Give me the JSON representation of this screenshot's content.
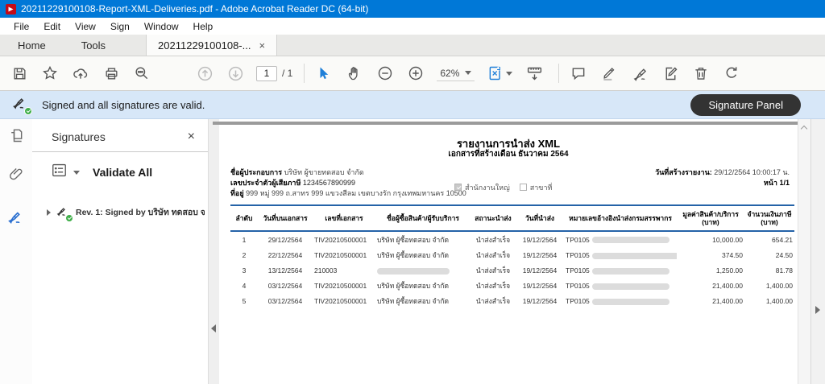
{
  "window": {
    "title": "20211229100108-Report-XML-Deliveries.pdf - Adobe Acrobat Reader DC (64-bit)"
  },
  "menu": {
    "items": [
      "File",
      "Edit",
      "View",
      "Sign",
      "Window",
      "Help"
    ]
  },
  "tab_bar": {
    "home": "Home",
    "tools": "Tools",
    "document": "20211229100108-...",
    "close_glyph": "×"
  },
  "toolbar": {
    "page_current": "1",
    "page_total": "/ 1",
    "zoom_level": "62%"
  },
  "signature_bar": {
    "message": "Signed and all signatures are valid.",
    "panel_button": "Signature Panel"
  },
  "signatures_panel": {
    "title": "Signatures",
    "close_glyph": "×",
    "validate_all": "Validate All",
    "revision": "Rev. 1: Signed by บริษัท ทดสอบ จ"
  },
  "pdf": {
    "title": "รายงานการนำส่ง XML",
    "subtitle": "เอกสารที่สร้างเดือน ธันวาคม 2564",
    "operator_label": "ชื่อผู้ประกอบการ",
    "operator_value": "บริษัท ผู้ขายทดสอบ จำกัด",
    "tax_id_label": "เลขประจำตัวผู้เสียภาษี",
    "tax_id_value": "1234567890999",
    "address_label": "ที่อยู่",
    "address_value": "999 หมู่ 999 ถ.สาทร 999 แขวงสีลม เขตบางรัก กรุงเทพมหานคร 10500",
    "head_office_label": "สำนักงานใหญ่",
    "branch_label": "สาขาที่",
    "report_date_label": "วันที่สร้างรายงาน:",
    "report_date_value": "29/12/2564 10:00:17 น.",
    "page_label": "หน้า 1/1",
    "table": {
      "columns": [
        {
          "label": "ลำดับ"
        },
        {
          "label": "วันที่บนเอกสาร"
        },
        {
          "label": "เลขที่เอกสาร"
        },
        {
          "label": "ชื่อผู้ซื้อสินค้า/ผู้รับบริการ"
        },
        {
          "label": "สถานะนำส่ง"
        },
        {
          "label": "วันที่นำส่ง"
        },
        {
          "label": "หมายเลขอ้างอิงนำส่งกรมสรรพากร"
        },
        {
          "label": "มูลค่าสินค้า/บริการ",
          "unit": "(บาท)"
        },
        {
          "label": "จำนวนเงินภาษี",
          "unit": "(บาท)"
        }
      ],
      "rows": [
        {
          "no": "1",
          "doc_date": "29/12/2564",
          "doc_no": "TIV20210500001",
          "buyer": "บริษัท ผู้ซื้อทดสอบ จำกัด",
          "status": "นำส่งสำเร็จ",
          "send_date": "19/12/2564",
          "ref": "TP0105",
          "amount": "10,000.00",
          "vat": "654.21"
        },
        {
          "no": "2",
          "doc_date": "22/12/2564",
          "doc_no": "TIV20210500001",
          "buyer": "บริษัท ผู้ซื้อทดสอบ จำกัด",
          "status": "นำส่งสำเร็จ",
          "send_date": "19/12/2564",
          "ref": "TP0105",
          "amount": "374.50",
          "vat": "24.50"
        },
        {
          "no": "3",
          "doc_date": "13/12/2564",
          "doc_no": "210003",
          "buyer": "",
          "status": "นำส่งสำเร็จ",
          "send_date": "19/12/2564",
          "ref": "TP0105",
          "amount": "1,250.00",
          "vat": "81.78"
        },
        {
          "no": "4",
          "doc_date": "03/12/2564",
          "doc_no": "TIV20210500001",
          "buyer": "บริษัท ผู้ซื้อทดสอบ จำกัด",
          "status": "นำส่งสำเร็จ",
          "send_date": "19/12/2564",
          "ref": "TP0105",
          "amount": "21,400.00",
          "vat": "1,400.00"
        },
        {
          "no": "5",
          "doc_date": "03/12/2564",
          "doc_no": "TIV20210500001",
          "buyer": "บริษัท ผู้ซื้อทดสอบ จำกัด",
          "status": "นำส่งสำเร็จ",
          "send_date": "19/12/2564",
          "ref": "TP0105",
          "amount": "21,400.00",
          "vat": "1,400.00"
        }
      ]
    }
  }
}
